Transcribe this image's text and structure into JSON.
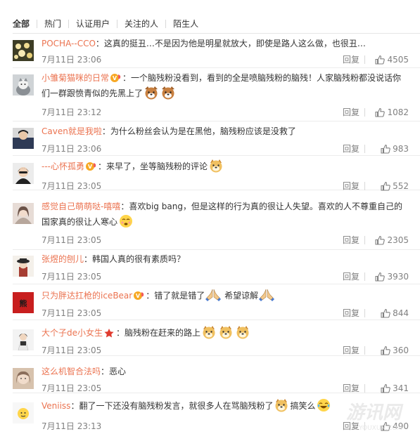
{
  "tabs": [
    {
      "label": "全部",
      "active": true
    },
    {
      "label": "热门",
      "active": false
    },
    {
      "label": "认证用户",
      "active": false
    },
    {
      "label": "关注的人",
      "active": false
    },
    {
      "label": "陌生人",
      "active": false
    }
  ],
  "comments": [
    {
      "user": "POCHA--CCO",
      "text": "这真的挺丑…不是因为他是明星就放大，即使是路人这么做，也很丑…",
      "time": "7月11日 23:06",
      "reply": "回复",
      "likes": "4505",
      "avatar_color": "#4a4a2a"
    },
    {
      "user": "小雏菊猫咪的日常",
      "text_parts": [
        "一个脑残粉没看到，看到的全是喷脑残粉的脑残！人家脑残粉都没说话你们一群跟愤青似的先黑上了"
      ],
      "time": "7月11日 23:12",
      "reply": "回复",
      "likes": "1082",
      "avatar_color": "#9aa0a6"
    },
    {
      "user": "Caven就是我啦",
      "text": "为什么粉丝会认为是在黑他，脑残粉应该是没救了",
      "time": "7月11日 23:06",
      "reply": "回复",
      "likes": "983",
      "avatar_color": "#3a4a6a"
    },
    {
      "user": "---心怀孤勇",
      "text": "来早了，坐等脑残粉的评论",
      "time": "7月11日 23:05",
      "reply": "回复",
      "likes": "552",
      "avatar_color": "#2a2a2a"
    },
    {
      "user": "感觉自己萌萌哒-嘻嘻",
      "text": "喜欢big bang，但是这样的行为真的很让人失望。喜欢的人不尊重自己的国家真的很让人寒心",
      "time": "7月11日 23:05",
      "reply": "回复",
      "likes": "2305",
      "avatar_color": "#c8b8b0"
    },
    {
      "user": "张煜的刨儿",
      "text": "韩国人真的很有素质吗？",
      "time": "7月11日 23:05",
      "reply": "回复",
      "likes": "3930",
      "avatar_color": "#b04a3a"
    },
    {
      "user": "只为胖达扛枪的iceBear",
      "text_a": "错了就是错了",
      "text_b": "希望谅解",
      "time": "7月11日 23:05",
      "reply": "回复",
      "likes": "844",
      "avatar_color": "#c81e1e"
    },
    {
      "user": "大个子de小女生",
      "text": "脑残粉在赶来的路上",
      "time": "7月11日 23:05",
      "reply": "回复",
      "likes": "360",
      "avatar_color": "#e8e8e8"
    },
    {
      "user": "这么机智合法吗",
      "text": "恶心",
      "time": "7月11日 23:05",
      "reply": "回复",
      "likes": "341",
      "avatar_color": "#c8a890"
    },
    {
      "user": "Veniiss",
      "text_a": "翻了一下还没有脑残粉发言，就很多人在骂脑残粉了",
      "text_b": "搞笑么",
      "time": "7月11日 23:13",
      "reply": "回复",
      "likes": "490",
      "avatar_color": "#f0f0f0"
    }
  ],
  "footer": {
    "prefix": "",
    "more": ""
  },
  "watermark": {
    "text": "游讯网",
    "sub": "YOUXUN.COM"
  },
  "colors": {
    "accent": "#eb7350",
    "muted": "#808080"
  }
}
